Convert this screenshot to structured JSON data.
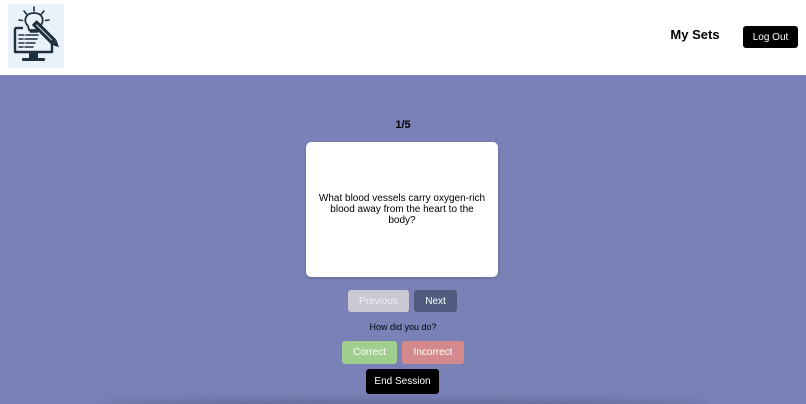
{
  "header": {
    "logo_icon": "lightbulb-computer-pencil-icon",
    "my_sets_label": "My Sets",
    "logout_label": "Log Out"
  },
  "study": {
    "counter": "1/5",
    "card_text": "What blood vessels carry oxygen-rich blood away from the heart to the body?",
    "previous_label": "Previous",
    "next_label": "Next",
    "how_did_label": "How did you do?",
    "correct_label": "Correct",
    "incorrect_label": "Incorrect",
    "end_session_label": "End Session"
  },
  "colors": {
    "background": "#7981b7",
    "header_bg": "#ffffff",
    "next_button": "#4f5c7f",
    "previous_button_disabled": "#c8c9d2",
    "correct_button": "#9fce8e",
    "incorrect_button": "#d48a8d",
    "primary_dark": "#000000"
  }
}
